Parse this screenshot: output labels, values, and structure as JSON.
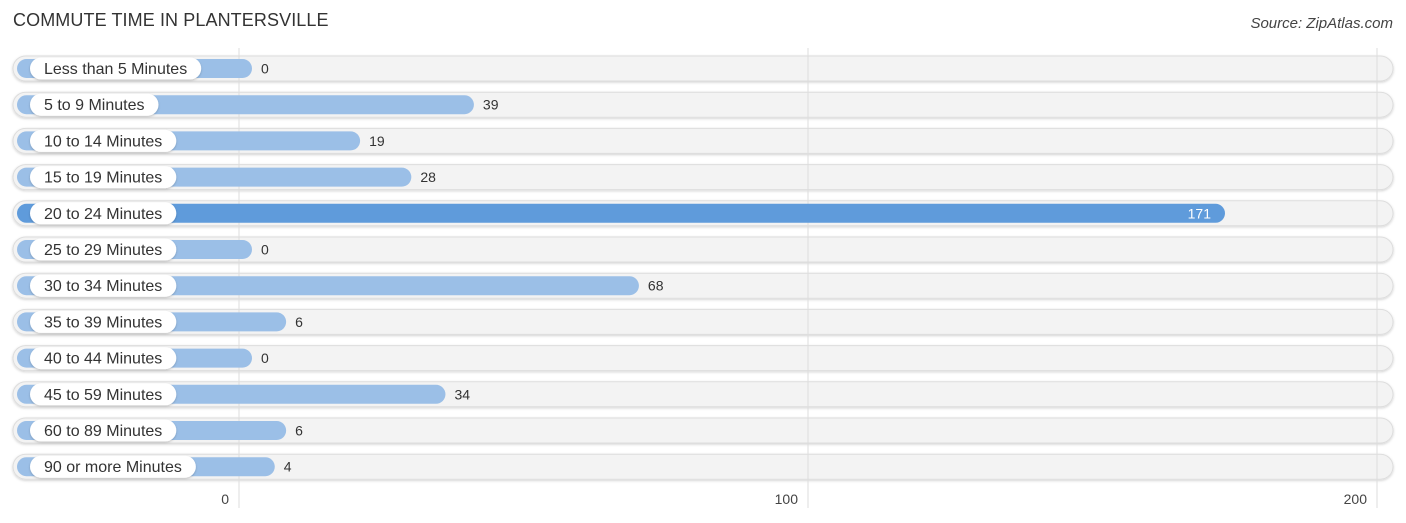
{
  "chart_data": {
    "type": "bar",
    "orientation": "horizontal",
    "title": "COMMUTE TIME IN PLANTERSVILLE",
    "source": "Source: ZipAtlas.com",
    "xlabel": "",
    "ylabel": "",
    "xlim": [
      0,
      200
    ],
    "ticks": [
      0,
      100,
      200
    ],
    "tick_labels": [
      "0",
      "100",
      "200"
    ],
    "grid": true,
    "highlight_index": 4,
    "colors": {
      "bar": "#9bbfe7",
      "bar_highlight": "#5f9bdb",
      "track": "#f3f3f3",
      "track_border": "#dddddd",
      "label_pill": "#ffffff",
      "grid": "#dddddd"
    },
    "categories": [
      "Less than 5 Minutes",
      "5 to 9 Minutes",
      "10 to 14 Minutes",
      "15 to 19 Minutes",
      "20 to 24 Minutes",
      "25 to 29 Minutes",
      "30 to 34 Minutes",
      "35 to 39 Minutes",
      "40 to 44 Minutes",
      "45 to 59 Minutes",
      "60 to 89 Minutes",
      "90 or more Minutes"
    ],
    "values": [
      0,
      39,
      19,
      28,
      171,
      0,
      68,
      6,
      0,
      34,
      6,
      4
    ]
  }
}
